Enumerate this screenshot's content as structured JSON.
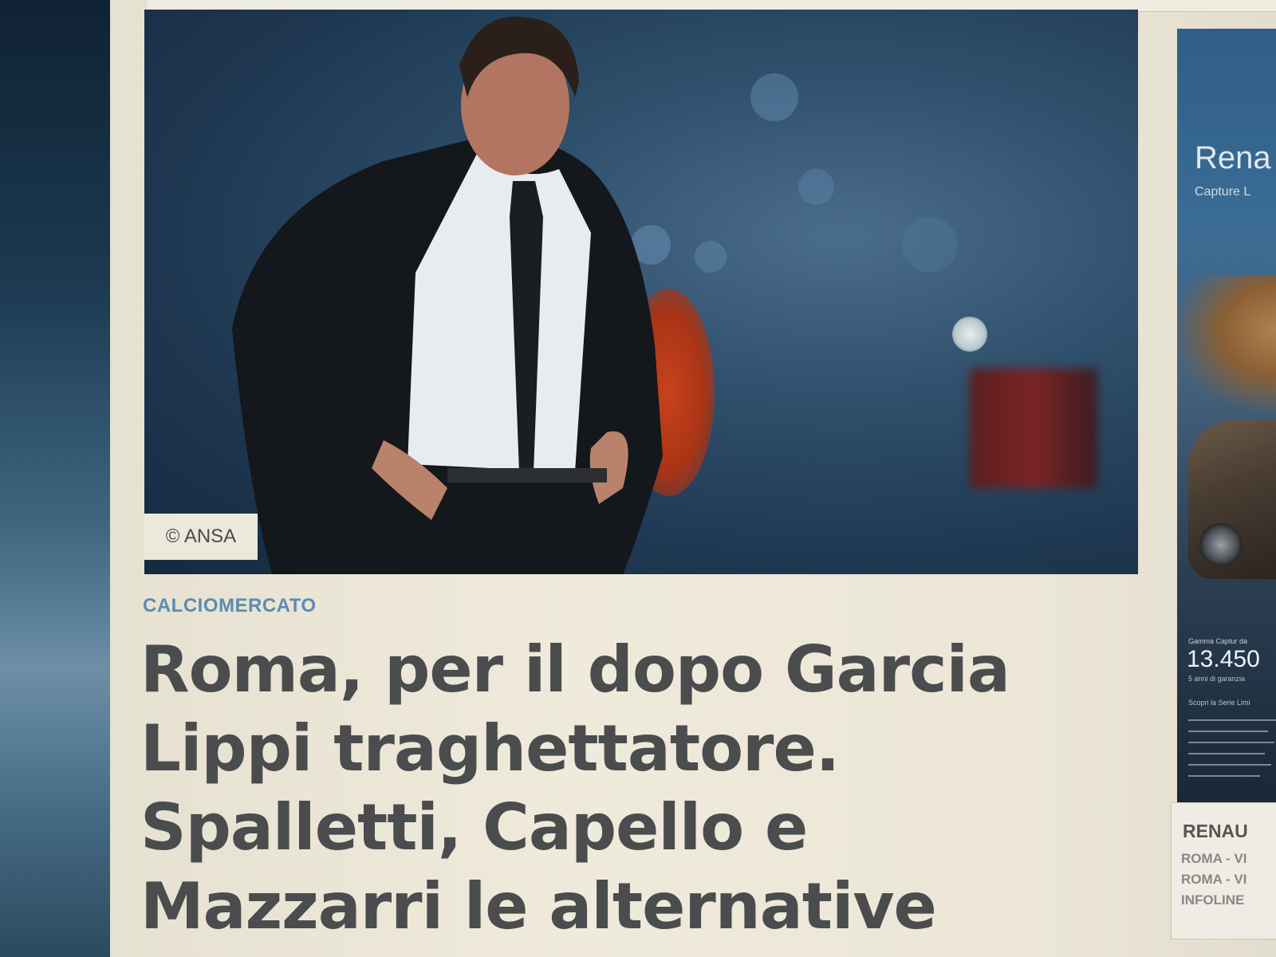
{
  "article": {
    "photo_credit": "© ANSA",
    "kicker": "CALCIOMERCATO",
    "headline_lines": [
      "Roma, per il dopo Garcia",
      "Lippi traghettatore.",
      "Spalletti, Capello e",
      "Mazzarri le alternative"
    ]
  },
  "ad": {
    "title": "Rena",
    "subtitle": "Capture L",
    "small_top": "Gamma Captur da",
    "price": "13.450",
    "small_mid": "5 anni di garanzia",
    "small_cta": "Scopri la Serie Limi",
    "footer": {
      "brand": "RENAU",
      "lines": [
        "ROMA - VI",
        "ROMA - VI",
        "INFOLINE"
      ]
    }
  },
  "colors": {
    "kicker": "#5d8bb2",
    "headline": "#4b4c4e",
    "page_bg": "#ebe6d6"
  }
}
